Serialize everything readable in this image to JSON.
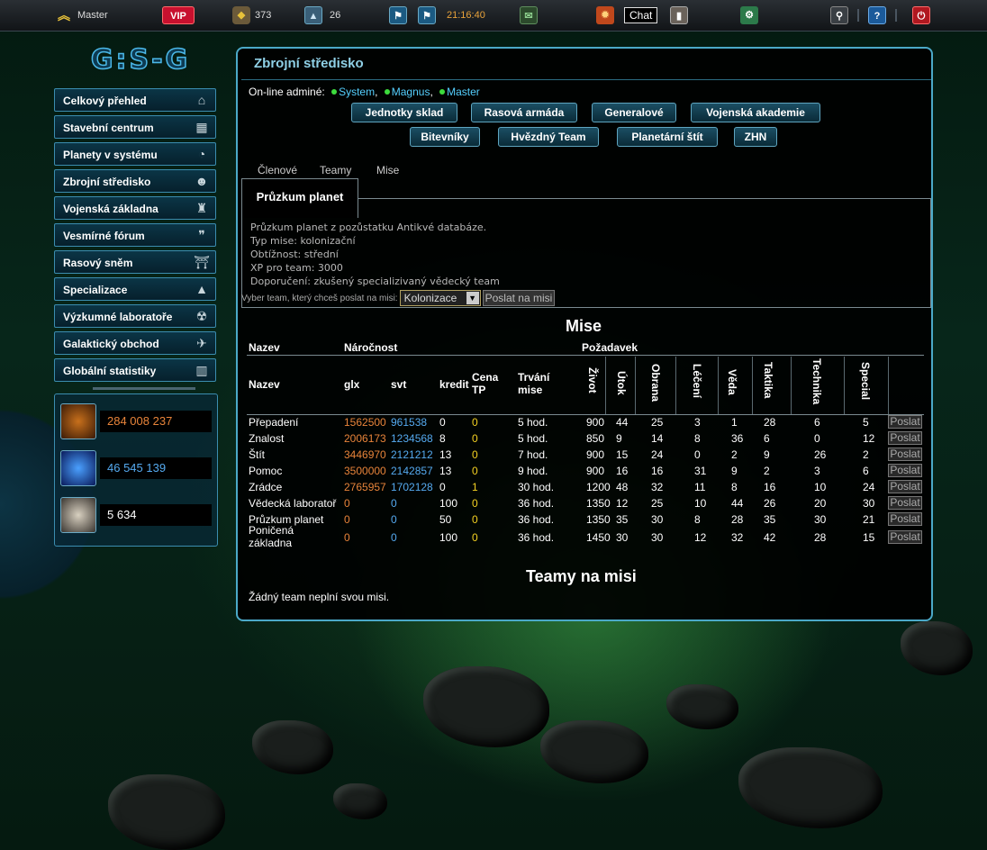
{
  "topbar": {
    "user": "Master",
    "vip": "VIP",
    "counter1": "373",
    "counter2": "26",
    "time": "21:16:40",
    "chat": "Chat",
    "help": "?",
    "colors": {
      "vip": "#c8102e",
      "time": "#e8a23a"
    }
  },
  "logo": "G:S-G",
  "sidebar": {
    "items": [
      {
        "label": "Celkový přehled",
        "icon": "home-icon"
      },
      {
        "label": "Stavební centrum",
        "icon": "building-icon"
      },
      {
        "label": "Planety v systému",
        "icon": "planet-icon"
      },
      {
        "label": "Zbrojní středisko",
        "icon": "soldier-icon"
      },
      {
        "label": "Vojenská základna",
        "icon": "base-icon"
      },
      {
        "label": "Vesmírné fórum",
        "icon": "chat-bubble-icon"
      },
      {
        "label": "Rasový sněm",
        "icon": "columns-icon"
      },
      {
        "label": "Specializace",
        "icon": "shapes-icon"
      },
      {
        "label": "Výzkumné laboratoře",
        "icon": "radiation-icon"
      },
      {
        "label": "Galaktický obchod",
        "icon": "tag-icon"
      },
      {
        "label": "Globální statistiky",
        "icon": "bar-chart-icon"
      }
    ]
  },
  "resources": [
    {
      "value": "284 008 237",
      "color": "#e8843a",
      "icon": "glx-crystal-icon"
    },
    {
      "value": "46 545 139",
      "color": "#55aaf0",
      "icon": "svt-energy-icon"
    },
    {
      "value": "5 634",
      "color": "#ffffff",
      "icon": "credit-metal-icon"
    }
  ],
  "main": {
    "title": "Zbrojní středisko",
    "online_label": "On-line adminé:",
    "admins": [
      "System",
      "Magnus",
      "Master"
    ],
    "nav_row1": [
      "Jednotky sklad",
      "Rasová armáda",
      "Generalové",
      "Vojenská akademie"
    ],
    "nav_row2": [
      "Bitevníky",
      "Hvězdný Team",
      "Planetární štít",
      "ZHN"
    ],
    "tabs": [
      "Členové",
      "Teamy",
      "Mise"
    ],
    "mission_tab": "Průzkum planet",
    "mission_desc": [
      "Průzkum planet z pozůstatku Antikvé databáze.",
      "Typ mise: kolonizační",
      "Obtížnost: střední",
      "XP pro team: 3000",
      "Doporučení: zkušený specializivaný vědecký team"
    ],
    "send_label": "Vyber team, který chceš poslat na misi:",
    "send_select": "Kolonizace",
    "send_button": "Poslat na misi",
    "mise_heading": "Mise",
    "table": {
      "group_headers": {
        "name": "Nazev",
        "difficulty": "Náročnost",
        "requirement": "Požadavek"
      },
      "col_headers": {
        "name": "Nazev",
        "glx": "glx",
        "svt": "svt",
        "kredit": "kredit",
        "cena_tp": "Cena TP",
        "trvani": "Trvání mise",
        "zivot": "Život",
        "utok": "Útok",
        "obrana": "Obrana",
        "leceni": "Léčení",
        "veda": "Věda",
        "taktika": "Taktika",
        "technika": "Technika",
        "special": "Special"
      },
      "rows": [
        {
          "name": "Přepadení",
          "glx": "1562500",
          "svt": "961538",
          "kredit": "0",
          "tp": "0",
          "time": "5 hod.",
          "zivot": "900",
          "utok": "44",
          "obrana": "25",
          "leceni": "3",
          "veda": "1",
          "taktika": "28",
          "technika": "6",
          "special": "5"
        },
        {
          "name": "Znalost",
          "glx": "2006173",
          "svt": "1234568",
          "kredit": "8",
          "tp": "0",
          "time": "5 hod.",
          "zivot": "850",
          "utok": "9",
          "obrana": "14",
          "leceni": "8",
          "veda": "36",
          "taktika": "6",
          "technika": "0",
          "special": "12"
        },
        {
          "name": "Štít",
          "glx": "3446970",
          "svt": "2121212",
          "kredit": "13",
          "tp": "0",
          "time": "7 hod.",
          "zivot": "900",
          "utok": "15",
          "obrana": "24",
          "leceni": "0",
          "veda": "2",
          "taktika": "9",
          "technika": "26",
          "special": "2"
        },
        {
          "name": "Pomoc",
          "glx": "3500000",
          "svt": "2142857",
          "kredit": "13",
          "tp": "0",
          "time": "9 hod.",
          "zivot": "900",
          "utok": "16",
          "obrana": "16",
          "leceni": "31",
          "veda": "9",
          "taktika": "2",
          "technika": "3",
          "special": "6"
        },
        {
          "name": "Zrádce",
          "glx": "2765957",
          "svt": "1702128",
          "kredit": "0",
          "tp": "1",
          "time": "30 hod.",
          "zivot": "1200",
          "utok": "48",
          "obrana": "32",
          "leceni": "11",
          "veda": "8",
          "taktika": "16",
          "technika": "10",
          "special": "24"
        },
        {
          "name": "Vědecká laboratoř",
          "glx": "0",
          "svt": "0",
          "kredit": "100",
          "tp": "0",
          "time": "36 hod.",
          "zivot": "1350",
          "utok": "12",
          "obrana": "25",
          "leceni": "10",
          "veda": "44",
          "taktika": "26",
          "technika": "20",
          "special": "30"
        },
        {
          "name": "Průzkum planet",
          "glx": "0",
          "svt": "0",
          "kredit": "50",
          "tp": "0",
          "time": "36 hod.",
          "zivot": "1350",
          "utok": "35",
          "obrana": "30",
          "leceni": "8",
          "veda": "28",
          "taktika": "35",
          "technika": "30",
          "special": "21"
        },
        {
          "name": "Poničená základna",
          "glx": "0",
          "svt": "0",
          "kredit": "100",
          "tp": "0",
          "time": "36 hod.",
          "zivot": "1450",
          "utok": "30",
          "obrana": "30",
          "leceni": "12",
          "veda": "32",
          "taktika": "42",
          "technika": "28",
          "special": "15"
        }
      ],
      "send_label": "Poslat"
    },
    "teams_heading": "Teamy na misi",
    "teams_empty": "Žádný team neplní svou misi."
  }
}
